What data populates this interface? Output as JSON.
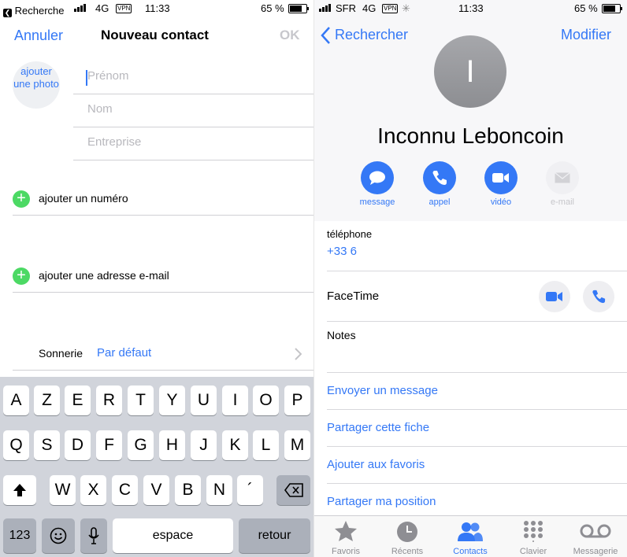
{
  "left_screen": {
    "status": {
      "back_app": "Recherche",
      "network": "4G",
      "vpn": "VPN",
      "time": "11:33",
      "battery": "65 %"
    },
    "nav": {
      "cancel": "Annuler",
      "title": "Nouveau contact",
      "ok": "OK"
    },
    "photo_label": "ajouter une photo",
    "fields": {
      "first_name_placeholder": "Prénom",
      "last_name_placeholder": "Nom",
      "company_placeholder": "Entreprise"
    },
    "add_phone": "ajouter un numéro",
    "add_email": "ajouter une adresse e-mail",
    "ringtone": {
      "label": "Sonnerie",
      "value": "Par défaut"
    },
    "keyboard": {
      "row1": [
        "A",
        "Z",
        "E",
        "R",
        "T",
        "Y",
        "U",
        "I",
        "O",
        "P"
      ],
      "row2": [
        "Q",
        "S",
        "D",
        "F",
        "G",
        "H",
        "J",
        "K",
        "L",
        "M"
      ],
      "row3": [
        "W",
        "X",
        "C",
        "V",
        "B",
        "N",
        "´"
      ],
      "numbers_key": "123",
      "space": "espace",
      "return": "retour"
    }
  },
  "right_screen": {
    "status": {
      "carrier": "SFR",
      "network": "4G",
      "vpn": "VPN",
      "time": "11:33",
      "battery": "65 %"
    },
    "nav": {
      "back": "Rechercher",
      "edit": "Modifier"
    },
    "avatar_initial": "I",
    "contact_name": "Inconnu Leboncoin",
    "actions": [
      {
        "label": "message",
        "icon": "message-bubble-icon",
        "enabled": true
      },
      {
        "label": "appel",
        "icon": "phone-icon",
        "enabled": true
      },
      {
        "label": "vidéo",
        "icon": "video-camera-icon",
        "enabled": true
      },
      {
        "label": "e-mail",
        "icon": "envelope-icon",
        "enabled": false
      }
    ],
    "phone": {
      "label": "téléphone",
      "number": "+33 6"
    },
    "facetime_label": "FaceTime",
    "notes_label": "Notes",
    "links": [
      "Envoyer un message",
      "Partager cette fiche",
      "Ajouter aux favoris",
      "Partager ma position"
    ],
    "tabs": [
      {
        "label": "Favoris",
        "icon": "star-icon",
        "active": false
      },
      {
        "label": "Récents",
        "icon": "clock-icon",
        "active": false
      },
      {
        "label": "Contacts",
        "icon": "contacts-icon",
        "active": true
      },
      {
        "label": "Clavier",
        "icon": "keypad-icon",
        "active": false
      },
      {
        "label": "Messagerie",
        "icon": "voicemail-icon",
        "active": false
      }
    ]
  },
  "colors": {
    "accent": "#3478f6",
    "add_green": "#4cd964",
    "keyboard_bg": "#d1d4db",
    "avatar_gray": "#9b9ca0"
  }
}
